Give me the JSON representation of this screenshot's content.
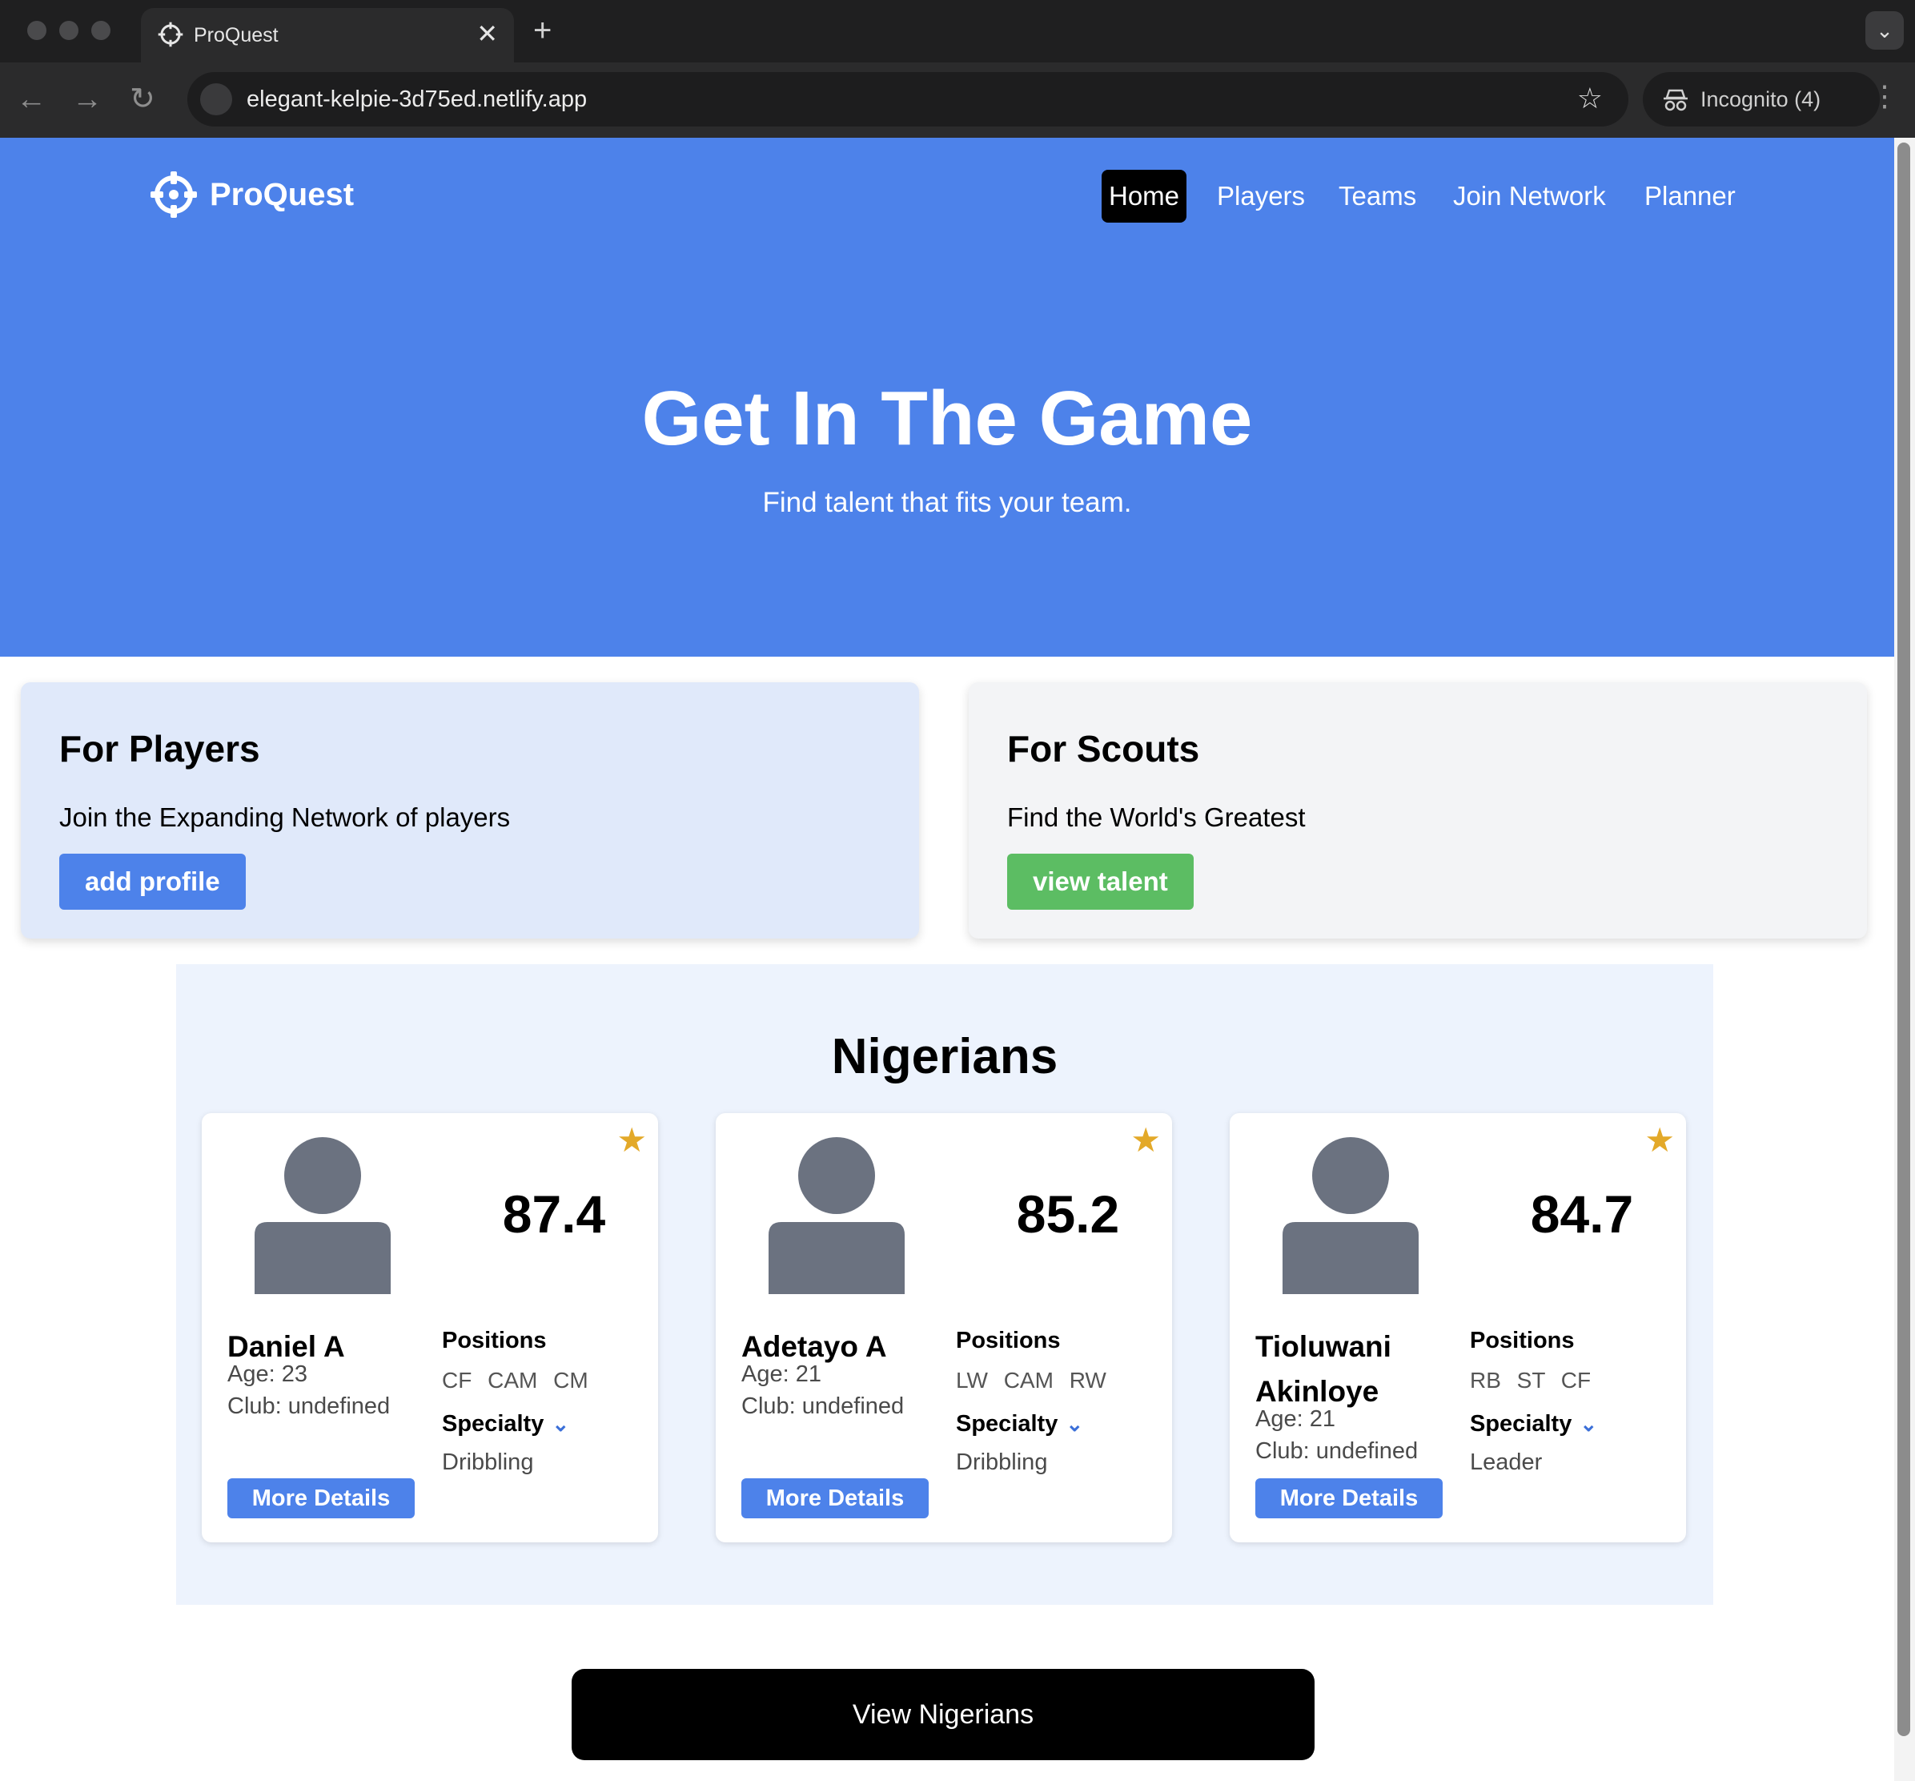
{
  "browser": {
    "tab_title": "ProQuest",
    "tab_close": "✕",
    "new_tab": "+",
    "url": "elegant-kelpie-3d75ed.netlify.app",
    "incognito_label": "Incognito (4)"
  },
  "site": {
    "brand": "ProQuest",
    "nav": [
      "Home",
      "Players",
      "Teams",
      "Join Network",
      "Planner"
    ],
    "active_nav": "Home"
  },
  "hero": {
    "title": "Get In The Game",
    "subtitle": "Find talent that fits your team."
  },
  "cards": {
    "players": {
      "title": "For Players",
      "text": "Join the Expanding Network of players",
      "button": "add profile"
    },
    "scouts": {
      "title": "For Scouts",
      "text": "Find the World's Greatest",
      "button": "view talent"
    }
  },
  "section": {
    "title": "Nigerians",
    "positions_label": "Positions",
    "specialty_label": "Specialty",
    "button_label": "More Details",
    "players": [
      {
        "name": "Daniel A",
        "age": "Age: 23",
        "club": "Club: undefined",
        "rating": "87.4",
        "positions": "CF CAM CM",
        "specialty": "Dribbling"
      },
      {
        "name": "Adetayo A",
        "age": "Age: 21",
        "club": "Club: undefined",
        "rating": "85.2",
        "positions": "LW CAM RW",
        "specialty": "Dribbling"
      },
      {
        "name": "Tioluwani Akinloye",
        "age": "Age: 21",
        "club": "Club: undefined",
        "rating": "84.7",
        "positions": "RB ST CF",
        "specialty": "Leader"
      }
    ],
    "view_all": "View Nigerians"
  },
  "colors": {
    "brand_blue": "#4d82ea",
    "scout_green": "#5cbd63",
    "star": "#e3a929",
    "avatar": "#6b7280"
  },
  "icons": {
    "logo": "crosshair-icon",
    "star": "star-icon",
    "avatar": "user-avatar-icon",
    "chevron": "chevron-down-icon"
  }
}
